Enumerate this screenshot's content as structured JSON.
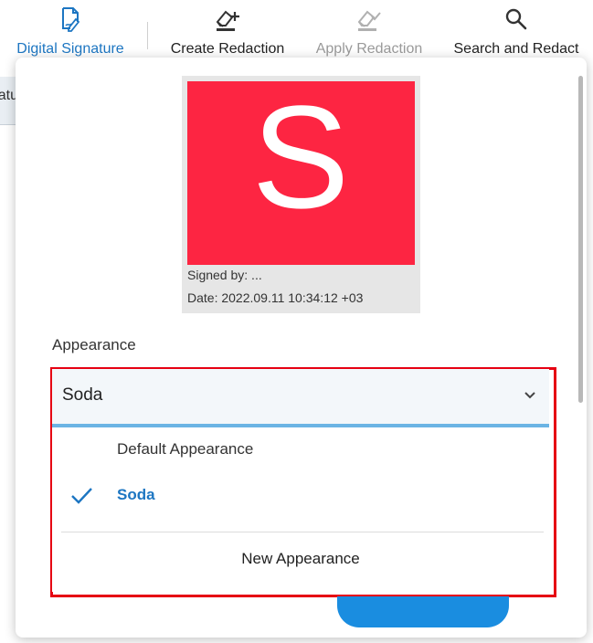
{
  "toolbar": {
    "items": [
      {
        "label": "Digital Signature",
        "icon": "signature-pen-icon",
        "state": "active"
      },
      {
        "label": "Create Redaction",
        "icon": "eraser-plus-icon",
        "state": "normal"
      },
      {
        "label": "Apply Redaction",
        "icon": "eraser-check-icon",
        "state": "disabled"
      },
      {
        "label": "Search and Redact",
        "icon": "search-icon",
        "state": "normal"
      }
    ]
  },
  "background": {
    "partial_text": "atu"
  },
  "signature": {
    "image_letter": "S",
    "image_color": "#fd2542",
    "signed_by": "Signed by: ...",
    "date": "Date: 2022.09.11 10:34:12 +03"
  },
  "appearance": {
    "label": "Appearance",
    "selected": "Soda",
    "options": [
      {
        "label": "Default Appearance",
        "selected": false
      },
      {
        "label": "Soda",
        "selected": true
      }
    ],
    "new_label": "New Appearance"
  },
  "colors": {
    "accent": "#1d76c2",
    "highlight_border": "#e60012",
    "select_underline": "#6bb4e4",
    "primary_button": "#1a8de0"
  }
}
